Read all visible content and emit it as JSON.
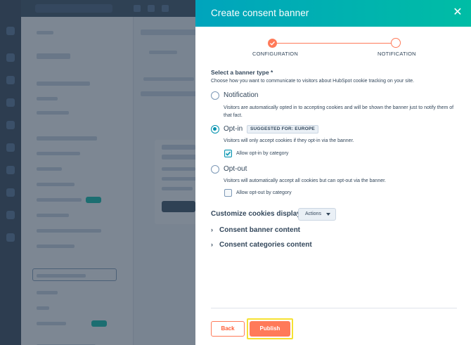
{
  "modal": {
    "title": "Create consent banner",
    "close_icon": "close-icon",
    "steps": [
      {
        "label": "CONFIGURATION",
        "state": "completed"
      },
      {
        "label": "NOTIFICATION",
        "state": "pending"
      }
    ],
    "banner_type": {
      "label": "Select a banner type *",
      "help": "Choose how you want to communicate to visitors about HubSpot cookie tracking on your site.",
      "options": [
        {
          "label": "Notification",
          "selected": false,
          "description": "Visitors are automatically opted in to accepting cookies and will be shown the banner just to notify them of that fact."
        },
        {
          "label": "Opt-in",
          "selected": true,
          "tag": "SUGGESTED FOR: EUROPE",
          "description": "Visitors will only accept cookies if they opt-in via the banner.",
          "checkbox_label": "Allow opt-in by category",
          "checkbox_checked": true
        },
        {
          "label": "Opt-out",
          "selected": false,
          "description": "Visitors will automatically accept all cookies but can opt-out via the banner.",
          "checkbox_label": "Allow opt-out by category",
          "checkbox_checked": false
        }
      ]
    },
    "customize": {
      "label": "Customize cookies display",
      "actions_label": "Actions"
    },
    "accordions": [
      {
        "label": "Consent banner content"
      },
      {
        "label": "Consent categories content"
      }
    ],
    "footer": {
      "back_label": "Back",
      "publish_label": "Publish"
    }
  },
  "colors": {
    "header_gradient_start": "#00a4bd",
    "header_gradient_end": "#00bda5",
    "accent_orange": "#ff7a59",
    "selection_blue": "#0091ae",
    "text": "#33475b",
    "highlight": "#f5e133"
  }
}
